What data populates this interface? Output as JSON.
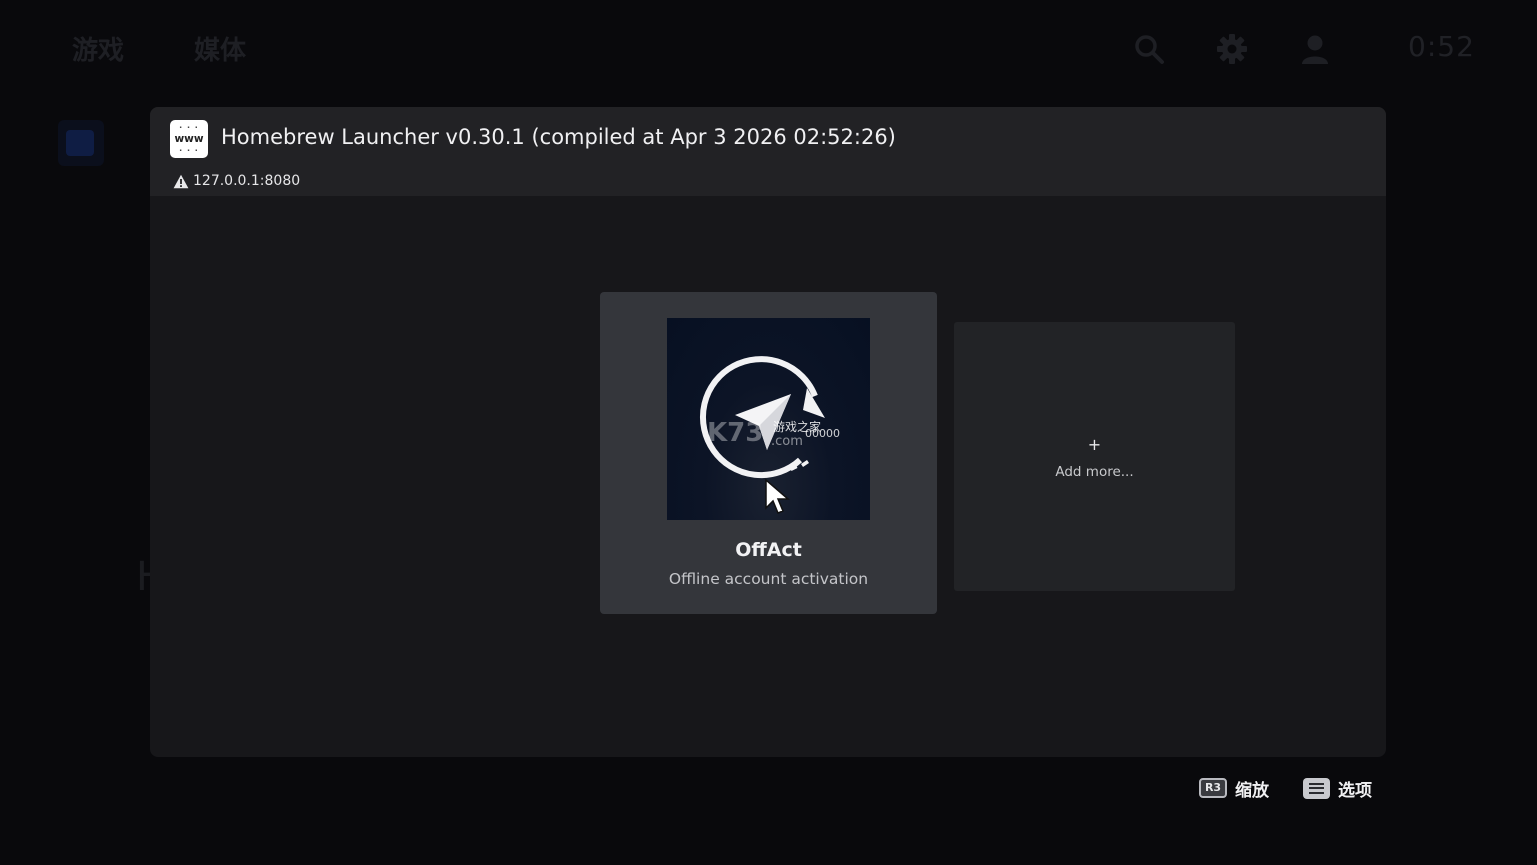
{
  "background": {
    "tabs": [
      "游戏",
      "媒体"
    ],
    "clock": "0:52",
    "partial_letter": "H",
    "icons": [
      "search-icon",
      "gear-icon",
      "user-icon"
    ]
  },
  "dialog": {
    "site_icon_text": "www",
    "title": "Homebrew Launcher v0.30.1 (compiled at Apr 3 2026 02:52:26)",
    "host": "127.0.0.1:8080",
    "host_icon": "warning-icon"
  },
  "apps": [
    {
      "name": "OffAct",
      "description": "Offline account activation",
      "thumbnail_icon": "sync-send-icon",
      "watermark": "K73游戏之家 .com 00000"
    }
  ],
  "add_card": {
    "plus": "+",
    "label": "Add more..."
  },
  "hints": {
    "zoom_button": "R3",
    "zoom_label": "缩放",
    "options_icon": "options-icon",
    "options_label": "选项"
  },
  "colors": {
    "background": "#09090c",
    "dialog": "#17171a",
    "header": "#222225",
    "card": "#34363b",
    "add_card": "#222326"
  }
}
